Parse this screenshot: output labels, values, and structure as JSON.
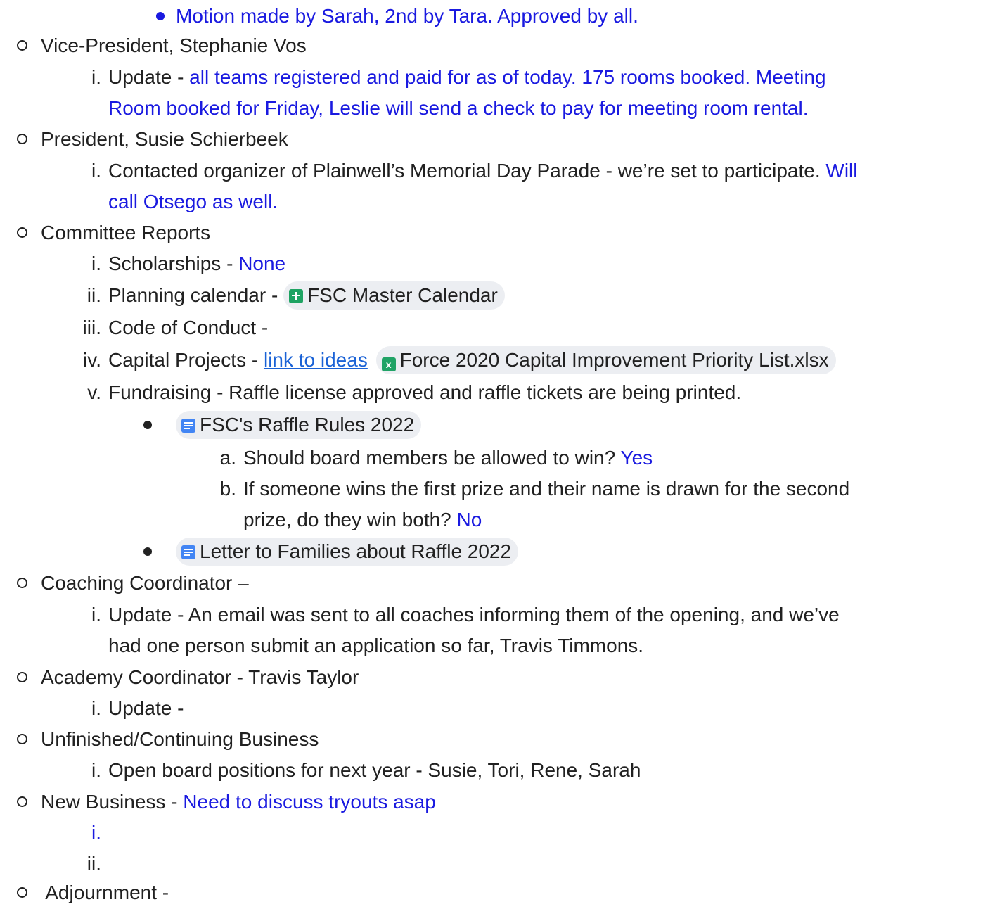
{
  "lines": {
    "l1": "Motion made by Sarah, 2nd by Tara.   Approved by all.",
    "vp": "Vice-President, Stephanie Vos",
    "vp_i_label": "i.",
    "vp_i_a": "Update - ",
    "vp_i_b": " all teams registered and paid for as of today.   175 rooms booked.   Meeting",
    "vp_i_c": "Room booked for Friday, Leslie will send a check to pay for meeting room rental.",
    "pres": "President, Susie Schierbeek",
    "pres_i_label": "i.",
    "pres_i_a": "Contacted organizer of Plainwell’s Memorial Day Parade - we’re set to participate.  ",
    "pres_i_b": "Will",
    "pres_i_c": "call Otsego as well.",
    "comm": "Committee Reports",
    "c_i_label": "i.",
    "c_i_a": "Scholarships - ",
    "c_i_b": "None",
    "c_ii_label": "ii.",
    "c_ii_a": "Planning calendar - ",
    "c_ii_chip": "FSC Master Calendar",
    "c_iii_label": "iii.",
    "c_iii_a": "Code of Conduct -",
    "c_iv_label": "iv.",
    "c_iv_a": "Capital Projects - ",
    "c_iv_link": "link to ideas",
    "c_iv_chip": "Force 2020 Capital Improvement Priority List.xlsx",
    "c_v_label": "v.",
    "c_v_a": "Fundraising - Raffle license approved and raffle tickets are being printed.",
    "raffle_chip": "FSC's Raffle Rules 2022",
    "q_a_label": "a.",
    "q_a_text": "Should board members be allowed to win? ",
    "q_a_ans": "Yes",
    "q_b_label": "b.",
    "q_b_text1": "If someone wins the first prize and their name is drawn for the second",
    "q_b_text2": "prize, do they win both? ",
    "q_b_ans": "No",
    "letter_chip": "Letter to Families about Raffle 2022",
    "coach": "Coaching Coordinator –",
    "coach_i_label": "i.",
    "coach_i_a": "Update  -  An email was sent to all coaches informing them of the opening, and we’ve",
    "coach_i_b": "had one person submit an application so far, Travis Timmons.",
    "acad": "Academy Coordinator - Travis Taylor",
    "acad_i_label": "i.",
    "acad_i_a": "Update -",
    "unf": "Unfinished/Continuing Business",
    "unf_i_label": "i.",
    "unf_i_a": "Open board positions for next year - Susie, Tori, Rene, Sarah",
    "newb_a": "New Business - ",
    "newb_b": " Need to discuss tryouts asap",
    "newb_i_label": "i.",
    "newb_ii_label": "ii.",
    "adj": " Adjournment -"
  },
  "icons": {
    "sheets": "google-sheets-icon",
    "excel": "excel-icon",
    "docs": "google-docs-icon",
    "excel_glyph": "x"
  },
  "colors": {
    "text": "#212121",
    "blue_text": "#1a1ae0",
    "link": "#1a62d6",
    "chip_bg": "#eceef2"
  }
}
